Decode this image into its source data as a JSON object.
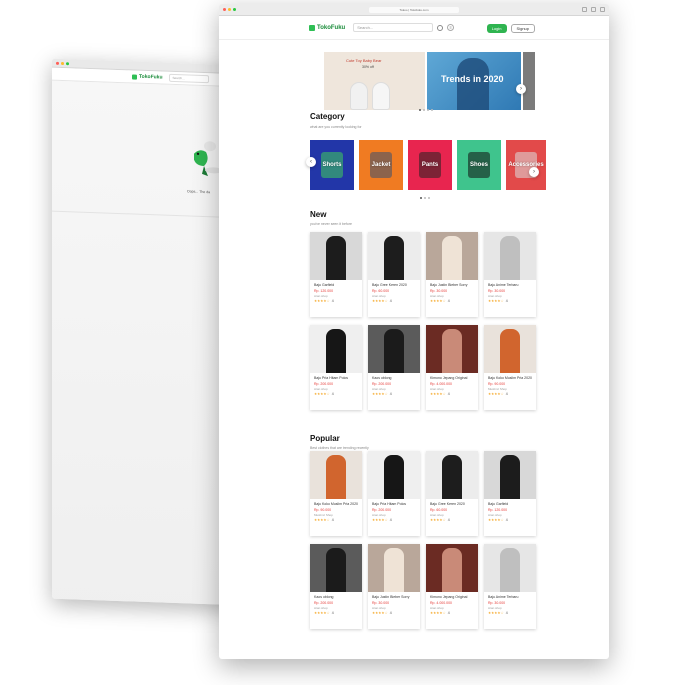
{
  "back_window": {
    "logo": "TokoFuku",
    "search_placeholder": "Search...",
    "message": "Oops... The da"
  },
  "browser": {
    "url": "Tokoo | Tokofuku.com",
    "colors": {
      "close": "#ff5f57",
      "minimize": "#febc2e",
      "maximize": "#28c840"
    }
  },
  "header": {
    "logo": "TokoFuku",
    "search_placeholder": "Search...",
    "login_label": "Login",
    "signup_label": "Signup",
    "accent": "#2fb450"
  },
  "banner": {
    "slide1_line1": "Cute Toy Baby Bear",
    "slide1_line2": "30% off",
    "slide2_text": "Trends in 2020",
    "active_dot": 1,
    "dot_count": 4
  },
  "category": {
    "title": "Category",
    "subtitle": "what are you currently looking for",
    "items": [
      {
        "label": "Shorts",
        "color": "#2236a8"
      },
      {
        "label": "Jacket",
        "color": "#f07b22"
      },
      {
        "label": "Pants",
        "color": "#e8254f"
      },
      {
        "label": "Shoes",
        "color": "#3fc48d"
      },
      {
        "label": "Accessories",
        "color": "#e24a4a"
      }
    ]
  },
  "new": {
    "title": "New",
    "subtitle": "you've never seen it before",
    "products": [
      {
        "name": "Baju Garfield",
        "price": "Rp. 120.000",
        "shop": "Aran shop",
        "rating": "4",
        "stars": "★★★★☆",
        "bg": "#d8d8d8",
        "fig": "#1c1c1c"
      },
      {
        "name": "Baju Gree Keren 2020",
        "price": "Rp. 60.000",
        "shop": "Aran shop",
        "rating": "4",
        "stars": "★★★★☆",
        "bg": "#ececec",
        "fig": "#1d1d1d"
      },
      {
        "name": "Baju Justin Bieber Sorry",
        "price": "Rp. 30.000",
        "shop": "Aran shop",
        "rating": "4",
        "stars": "★★★★☆",
        "bg": "#b9a79a",
        "fig": "#efe3d6"
      },
      {
        "name": "Baju Anime Terbaru",
        "price": "Rp. 30.000",
        "shop": "Aran shop",
        "rating": "4",
        "stars": "★★★★☆",
        "bg": "#e6e6e6",
        "fig": "#bfbfbf"
      },
      {
        "name": "Baju Pria Hitam Polos",
        "price": "Rp. 200.000",
        "shop": "Aran shop",
        "rating": "4",
        "stars": "★★★★☆",
        "bg": "#efefef",
        "fig": "#161616"
      },
      {
        "name": "Kaos oblong",
        "price": "Rp. 200.000",
        "shop": "Aran shop",
        "rating": "4",
        "stars": "★★★★☆",
        "bg": "#5b5b5b",
        "fig": "#1b1b1b"
      },
      {
        "name": "Kimono Jepang Original",
        "price": "Rp. 4.000.000",
        "shop": "Aran shop",
        "rating": "4",
        "stars": "★★★★☆",
        "bg": "#6b2b23",
        "fig": "#c98a78"
      },
      {
        "name": "Baju Koko Muslim Pria 2020",
        "price": "Rp. 90.000",
        "shop": "Muslimz Shop",
        "rating": "4",
        "stars": "★★★★☆",
        "bg": "#e9e2db",
        "fig": "#d1652e"
      }
    ]
  },
  "popular": {
    "title": "Popular",
    "subtitle": "Best clothes that are trending recently",
    "products": [
      {
        "name": "Baju Koko Muslim Pria 2020",
        "price": "Rp. 90.000",
        "shop": "Muslimz Shop",
        "rating": "4",
        "stars": "★★★★☆",
        "bg": "#e9e2db",
        "fig": "#d1652e"
      },
      {
        "name": "Baju Pria Hitam Polos",
        "price": "Rp. 200.000",
        "shop": "Aran shop",
        "rating": "4",
        "stars": "★★★★☆",
        "bg": "#efefef",
        "fig": "#161616"
      },
      {
        "name": "Baju Gree Keren 2020",
        "price": "Rp. 60.000",
        "shop": "Aran shop",
        "rating": "4",
        "stars": "★★★★☆",
        "bg": "#ececec",
        "fig": "#1d1d1d"
      },
      {
        "name": "Baju Garfield",
        "price": "Rp. 120.000",
        "shop": "Aran shop",
        "rating": "4",
        "stars": "★★★★☆",
        "bg": "#d8d8d8",
        "fig": "#1c1c1c"
      },
      {
        "name": "Kaos oblong",
        "price": "Rp. 200.000",
        "shop": "Aran shop",
        "rating": "4",
        "stars": "★★★★☆",
        "bg": "#5b5b5b",
        "fig": "#1b1b1b"
      },
      {
        "name": "Baju Justin Bieber Sorry",
        "price": "Rp. 30.000",
        "shop": "Aran shop",
        "rating": "4",
        "stars": "★★★★☆",
        "bg": "#b9a79a",
        "fig": "#efe3d6"
      },
      {
        "name": "Kimono Jepang Original",
        "price": "Rp. 4.000.000",
        "shop": "Aran shop",
        "rating": "4",
        "stars": "★★★★☆",
        "bg": "#6b2b23",
        "fig": "#c98a78"
      },
      {
        "name": "Baju Anime Terbaru",
        "price": "Rp. 30.000",
        "shop": "Aran shop",
        "rating": "4",
        "stars": "★★★★☆",
        "bg": "#e6e6e6",
        "fig": "#bfbfbf"
      }
    ]
  }
}
